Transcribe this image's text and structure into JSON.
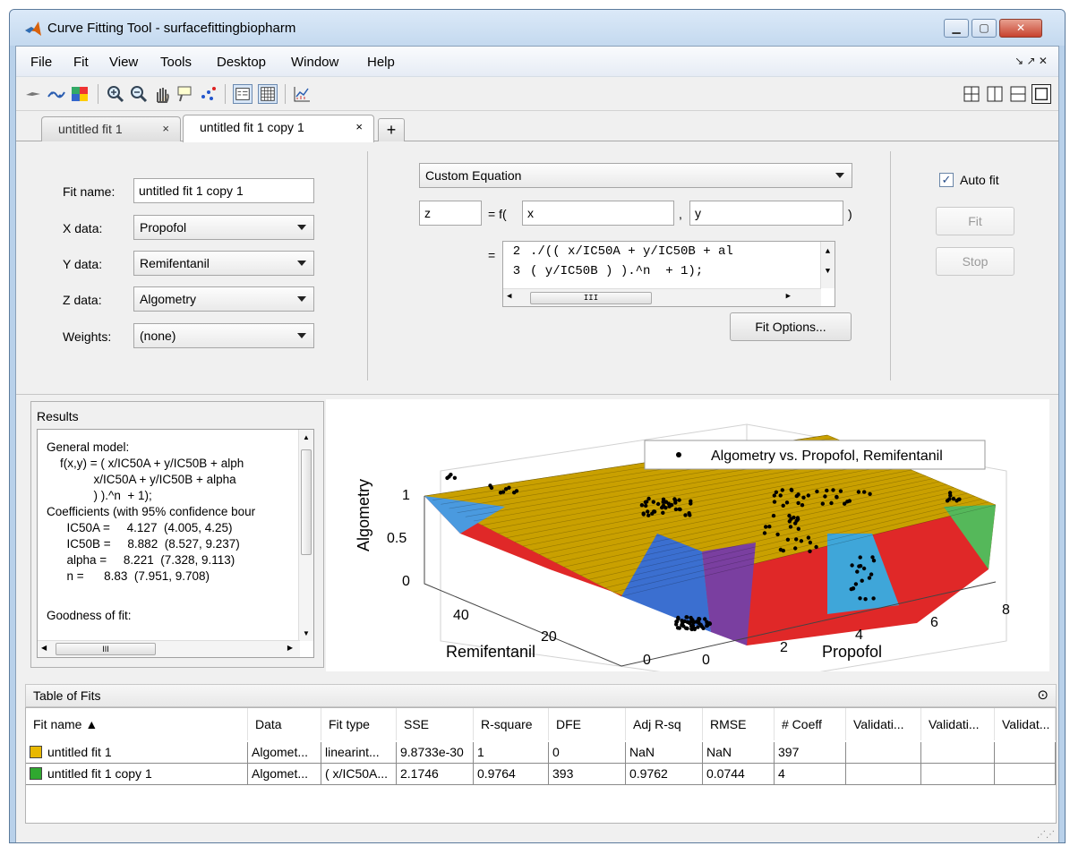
{
  "window": {
    "title": "Curve Fitting Tool - surfacefittingbiopharm",
    "controls": {
      "minimize": "▁",
      "maximize": "▢",
      "close": "✕"
    }
  },
  "menu": {
    "items": [
      "File",
      "Fit",
      "View",
      "Tools",
      "Desktop",
      "Window",
      "Help"
    ],
    "right": "↘  ↗ ✕"
  },
  "toolbar": {
    "icons": [
      "data-cursor-icon",
      "exclude-icon",
      "colormap-icon",
      "zoom-in-icon",
      "zoom-out-icon",
      "pan-icon",
      "data-cursor-icon",
      "exclude-outliers-icon",
      "legend-icon",
      "grid-icon",
      "residuals-icon"
    ],
    "layout_icons": [
      "tile-2x2-icon",
      "tile-vertical-icon",
      "tile-horizontal-icon",
      "single-icon"
    ]
  },
  "tabs": [
    {
      "label": "untitled fit 1",
      "close": "×"
    },
    {
      "label": "untitled fit 1 copy 1",
      "close": "×"
    }
  ],
  "tab_add": "+",
  "fit": {
    "name_label": "Fit name:",
    "name_value": "untitled fit 1 copy 1",
    "x_label": "X data:",
    "x_value": "Propofol",
    "y_label": "Y data:",
    "y_value": "Remifentanil",
    "z_label": "Z data:",
    "z_value": "Algometry",
    "w_label": "Weights:",
    "w_value": "(none)",
    "type_value": "Custom Equation",
    "out_var": "z",
    "eq_prefix": "= f(",
    "in_x": "x",
    "comma": ",",
    "in_y": "y",
    "close_paren": ")",
    "eq_equals": "=",
    "eq_lines": [
      {
        "num": "2",
        "text": "./(( x/IC50A + y/IC50B + al"
      },
      {
        "num": "3",
        "text": "( y/IC50B ) ).^n  + 1);"
      }
    ],
    "eq_scroll_marker": "III",
    "fit_options": "Fit Options...",
    "auto_fit_label": "Auto fit",
    "auto_fit_checked": "✓",
    "fit_button": "Fit",
    "stop_button": "Stop"
  },
  "results": {
    "label": "Results",
    "lines": [
      "General model:",
      "    f(x,y) = ( x/IC50A + y/IC50B + alph",
      "              x/IC50A + y/IC50B + alpha",
      "              ) ).^n  + 1);",
      "Coefficients (with 95% confidence bour",
      "      IC50A =     4.127  (4.005, 4.25)",
      "      IC50B =     8.882  (8.527, 9.237)",
      "      alpha =     8.221  (7.328, 9.113)",
      "      n =      8.83  (7.951, 9.708)",
      "",
      "Goodness of fit:"
    ],
    "scroll_marker": "III"
  },
  "plot": {
    "legend": "Algometry vs. Propofol, Remifentanil",
    "zlabel": "Algometry",
    "ylabel": "Remifentanil",
    "xlabel": "Propofol",
    "z_ticks": [
      "1",
      "0.5",
      "0"
    ],
    "y_ticks": [
      "40",
      "20",
      "0"
    ],
    "x_ticks": [
      "0",
      "2",
      "4",
      "6",
      "8"
    ]
  },
  "table": {
    "title": "Table of Fits",
    "collapse_icon": "⊙",
    "headers": [
      "Fit name ▲",
      "Data",
      "Fit type",
      "SSE",
      "R-square",
      "DFE",
      "Adj R-sq",
      "RMSE",
      "# Coeff",
      "Validati...",
      "Validati...",
      "Validat..."
    ],
    "rows": [
      {
        "swatch": "#e8b800",
        "cells": [
          "untitled fit 1",
          "Algomet...",
          "linearint...",
          "9.8733e-30",
          "1",
          "0",
          "NaN",
          "NaN",
          "397",
          "",
          "",
          ""
        ]
      },
      {
        "swatch": "#2fa82f",
        "cells": [
          "untitled fit 1 copy 1",
          "Algomet...",
          "( x/IC50A...",
          "2.1746",
          "0.9764",
          "393",
          "0.9762",
          "0.0744",
          "4",
          "",
          "",
          ""
        ]
      }
    ]
  },
  "colors": {
    "title_bg": "#c4d9ef",
    "panel_bg": "#f0f0f0",
    "surface_top": "#c9a000",
    "surface_red": "#e02020"
  }
}
